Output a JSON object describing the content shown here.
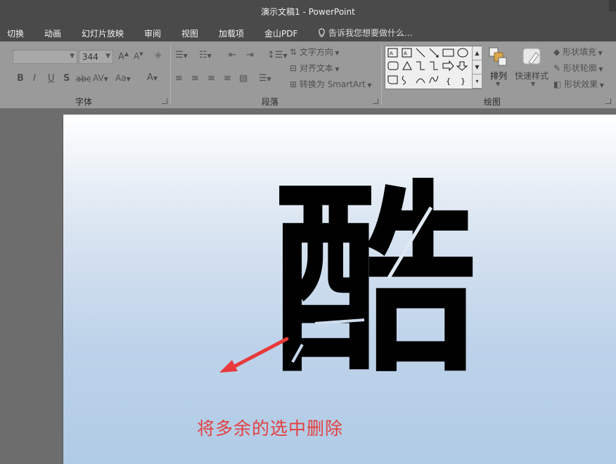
{
  "window": {
    "title": "演示文稿1 - PowerPoint"
  },
  "tabs": [
    "切换",
    "动画",
    "幻灯片放映",
    "审阅",
    "视图",
    "加载项",
    "金山PDF"
  ],
  "tell_me": {
    "placeholder": "告诉我您想要做什么..."
  },
  "ribbon": {
    "font_group": {
      "label": "字体",
      "font_name": "",
      "font_size": "344",
      "grow_label": "A",
      "shrink_label": "A",
      "bold": "B",
      "italic": "I",
      "underline": "U",
      "shadow": "S",
      "strike": "abc",
      "spacing": "AV",
      "case": "Aa",
      "color": "A"
    },
    "paragraph_group": {
      "label": "段落",
      "text_direction": "文字方向",
      "align_text": "对齐文本",
      "convert_smartart": "转换为 SmartArt"
    },
    "drawing_group": {
      "label": "绘图",
      "arrange": "排列",
      "quick_styles": "快速样式",
      "shape_fill": "形状填充",
      "shape_outline": "形状轮廓",
      "shape_effects": "形状效果"
    }
  },
  "slide": {
    "character": "酷",
    "annotation": "将多余的选中删除",
    "annotation_color": "#e34040"
  },
  "colors": {
    "titlebar": "#4a4a4a",
    "ribbon": "#9a9a9a",
    "workspace": "#6d6d6d"
  }
}
